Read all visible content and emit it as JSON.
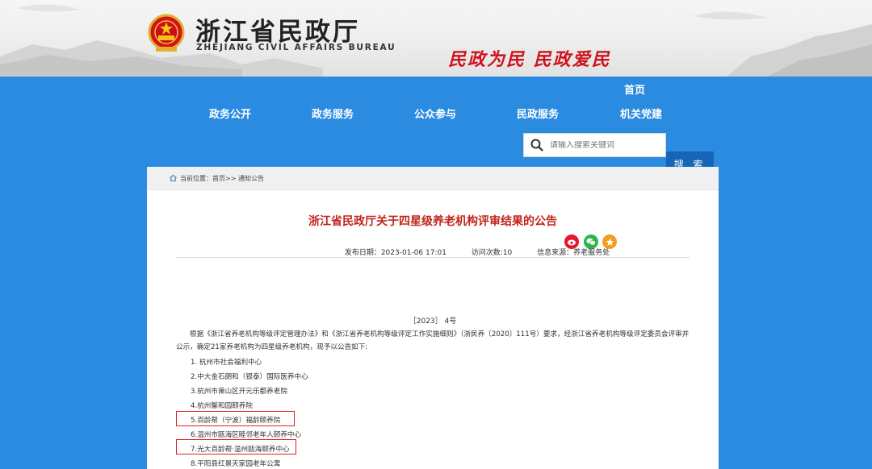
{
  "header": {
    "site_name": "浙江省民政厅",
    "site_name_en": "ZHEJIANG CIVIL AFFAIRS BUREAU",
    "slogan": "民政为民  民政爱民",
    "emblem_icon": "national-emblem-icon"
  },
  "nav": {
    "background": "#2a8be0",
    "home": "首页",
    "items": [
      "政务公开",
      "政务服务",
      "公众参与",
      "民政服务",
      "机关党建"
    ]
  },
  "search": {
    "placeholder": "请输入搜索关键词",
    "button_label": "搜 索"
  },
  "breadcrumb": "当前位置：首页>> 通知公告",
  "article": {
    "title": "浙江省民政厅关于四星级养老机构评审结果的公告",
    "publish_date": "发布日期：2023-01-06 17:01",
    "visits": "访问次数:10",
    "source": "信息来源：养老服务处",
    "doc_number": "［2023］ 4号",
    "paragraph": "根据《浙江省养老机构等级评定管理办法》和《浙江省养老机构等级评定工作实施细则》（浙民养〔2020〕111号）要求，经浙江省养老机构等级评定委员会评审并公示，确定21家养老机构为四星级养老机构，现予以公告如下:",
    "list": [
      "1. 杭州市社会福利中心",
      "2.中大金石朗和（银泰）国际医养中心",
      "3.杭州市萧山区开元乐都养老院",
      "4.杭州馨和园颐养院",
      "5.百龄帮（宁波）福龄颐养院",
      "6.温州市瓯海区睦邻老年人颐养中心",
      "7.光大百龄帮·温州瓯海颐养中心",
      "8.平阳县红景天家园老年公寓"
    ]
  },
  "share": [
    {
      "icon": "weibo-icon",
      "color": "#e6162d"
    },
    {
      "icon": "wechat-icon",
      "color": "#2cb64a"
    },
    {
      "icon": "favorite-star-icon",
      "color": "#f0a020"
    }
  ],
  "highlight_color": "#e0211f"
}
